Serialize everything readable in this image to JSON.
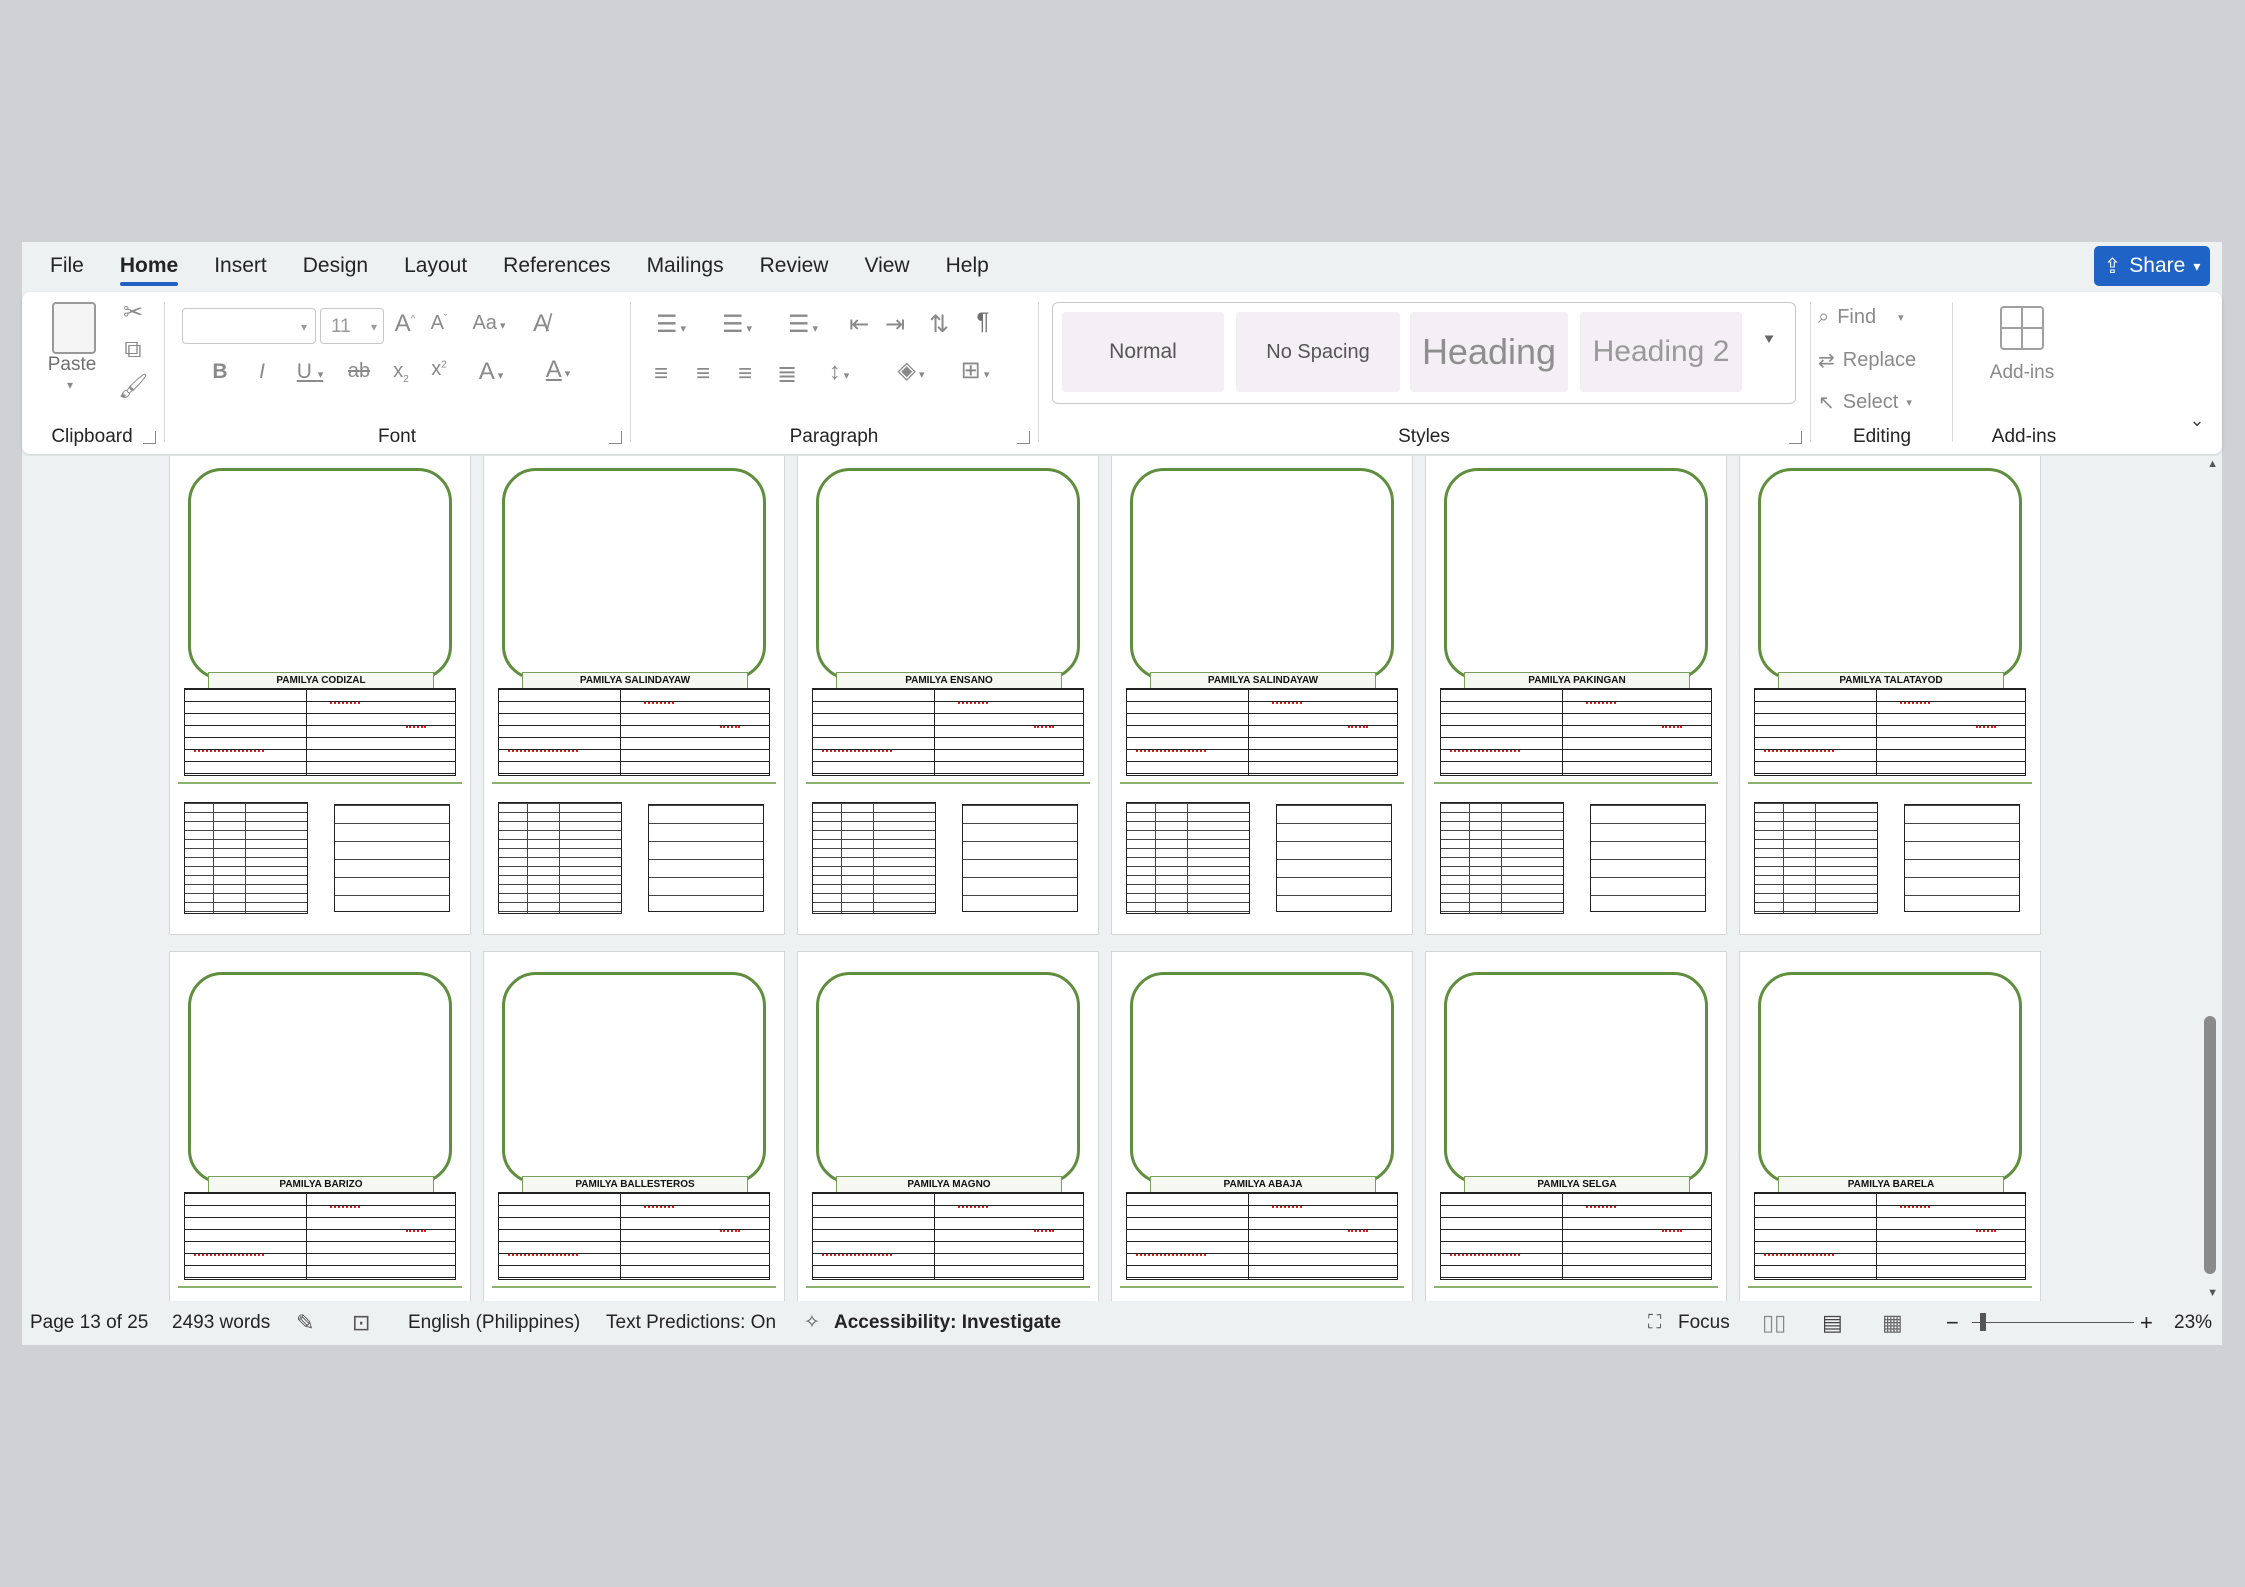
{
  "menu": {
    "tabs": [
      "File",
      "Home",
      "Insert",
      "Design",
      "Layout",
      "References",
      "Mailings",
      "Review",
      "View",
      "Help"
    ],
    "active": "Home",
    "share_label": "Share"
  },
  "ribbon": {
    "clipboard": {
      "paste_label": "Paste",
      "group_label": "Clipboard"
    },
    "font": {
      "font_name": "",
      "font_size": "11",
      "group_label": "Font",
      "change_case": "Aa"
    },
    "paragraph": {
      "group_label": "Paragraph"
    },
    "styles": {
      "group_label": "Styles",
      "items": [
        "Normal",
        "No Spacing",
        "Heading",
        "Heading 2"
      ]
    },
    "editing": {
      "group_label": "Editing",
      "find": "Find",
      "replace": "Replace",
      "select": "Select"
    },
    "addins": {
      "group_label": "Add-ins",
      "button_label": "Add-ins"
    }
  },
  "document": {
    "rows": [
      [
        "PAMILYA CODIZAL",
        "PAMILYA SALINDAYAW",
        "PAMILYA ENSANO",
        "PAMILYA SALINDAYAW",
        "PAMILYA PAKINGAN",
        "PAMILYA TALATAYOD"
      ],
      [
        "PAMILYA BARIZO",
        "PAMILYA BALLESTEROS",
        "PAMILYA MAGNO",
        "PAMILYA ABAJA",
        "PAMILYA SELGA",
        "PAMILYA BARELA"
      ]
    ]
  },
  "status": {
    "page": "Page 13 of 25",
    "words": "2493 words",
    "language": "English (Philippines)",
    "predictions": "Text Predictions: On",
    "accessibility": "Accessibility: Investigate",
    "focus": "Focus",
    "zoom": "23%"
  },
  "colors": {
    "accent": "#1f63c6",
    "card_border": "#5f8f3e"
  }
}
